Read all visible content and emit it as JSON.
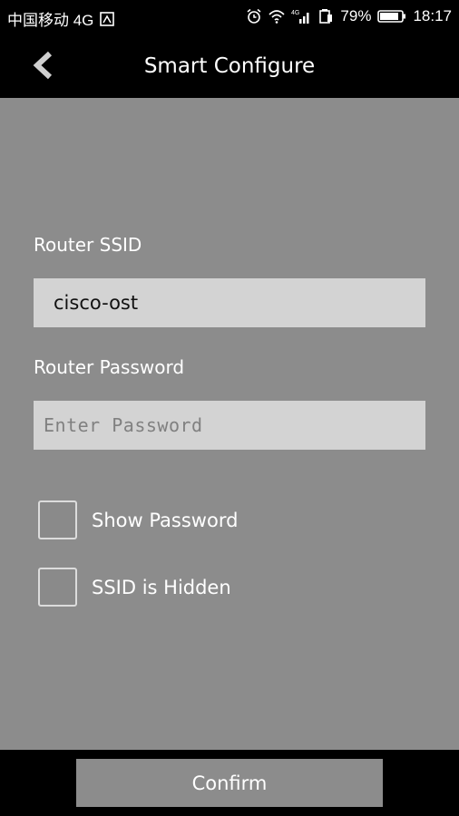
{
  "status_bar": {
    "carrier": "中国移动 4G",
    "network_type": "4G",
    "battery": "79%",
    "time": "18:17",
    "icons": [
      "sim-icon",
      "alarm-icon",
      "wifi-icon",
      "signal-icon",
      "battery-saver-icon",
      "battery-icon"
    ]
  },
  "header": {
    "title": "Smart Configure",
    "back_icon": "chevron-left-icon"
  },
  "form": {
    "ssid_label": "Router SSID",
    "ssid_value": "cisco-ost",
    "password_label": "Router Password",
    "password_value": "",
    "password_placeholder": "Enter Password",
    "show_password_label": "Show Password",
    "show_password_checked": false,
    "ssid_hidden_label": "SSID is Hidden",
    "ssid_hidden_checked": false
  },
  "footer": {
    "confirm_label": "Confirm"
  },
  "colors": {
    "background": "#8c8c8c",
    "bars": "#000000",
    "field": "#d3d3d3",
    "text": "#ffffff"
  }
}
